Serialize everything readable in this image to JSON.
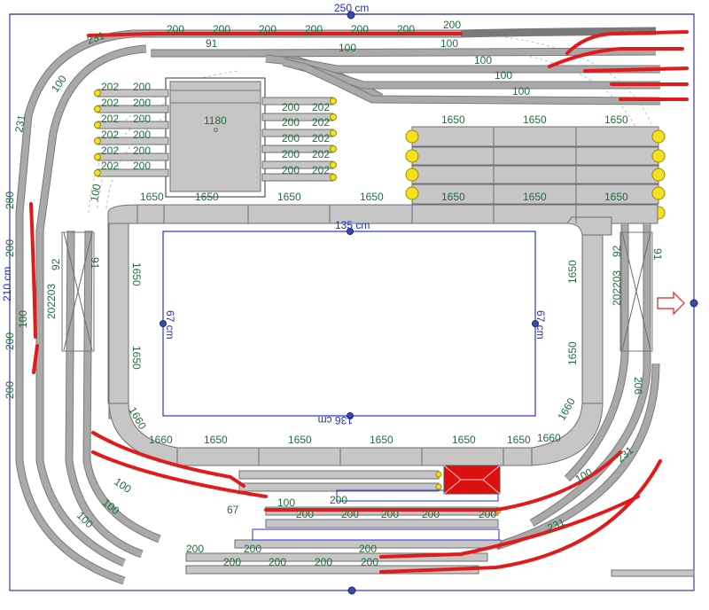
{
  "dimensions": {
    "width_label": "250 cm",
    "height_label": "210 cm",
    "inner_width_top": "135 cm",
    "inner_width_bottom": "136 cm",
    "inner_height_left": "67 cm",
    "inner_height_right": "67 cm"
  },
  "labels": {
    "top": [
      "200",
      "200",
      "200",
      "200",
      "200",
      "200",
      "200",
      "200"
    ],
    "top_231": "231",
    "l91": "91",
    "l100a": "100",
    "l100b": "100",
    "l100c": "100",
    "l100d": "100",
    "l100e": "100",
    "l100f": "100",
    "l202": "202",
    "l200": "200",
    "turntable": "1180",
    "yard_1650": "1650",
    "loop_1650": "1650",
    "l1660": "1660",
    "l200_left": "200",
    "l92": "92",
    "l202203": "202203",
    "l231": "231",
    "l100": "100",
    "l280": "280",
    "l206": "206",
    "l67": "67"
  },
  "colors": {
    "track_fill": "#c6c6c6",
    "track_edge": "#6f6f6f",
    "label": "#1f6f3c",
    "dimension": "#1d2bd6",
    "marker": "#e31a1a",
    "bumper": "#f5e21c"
  }
}
